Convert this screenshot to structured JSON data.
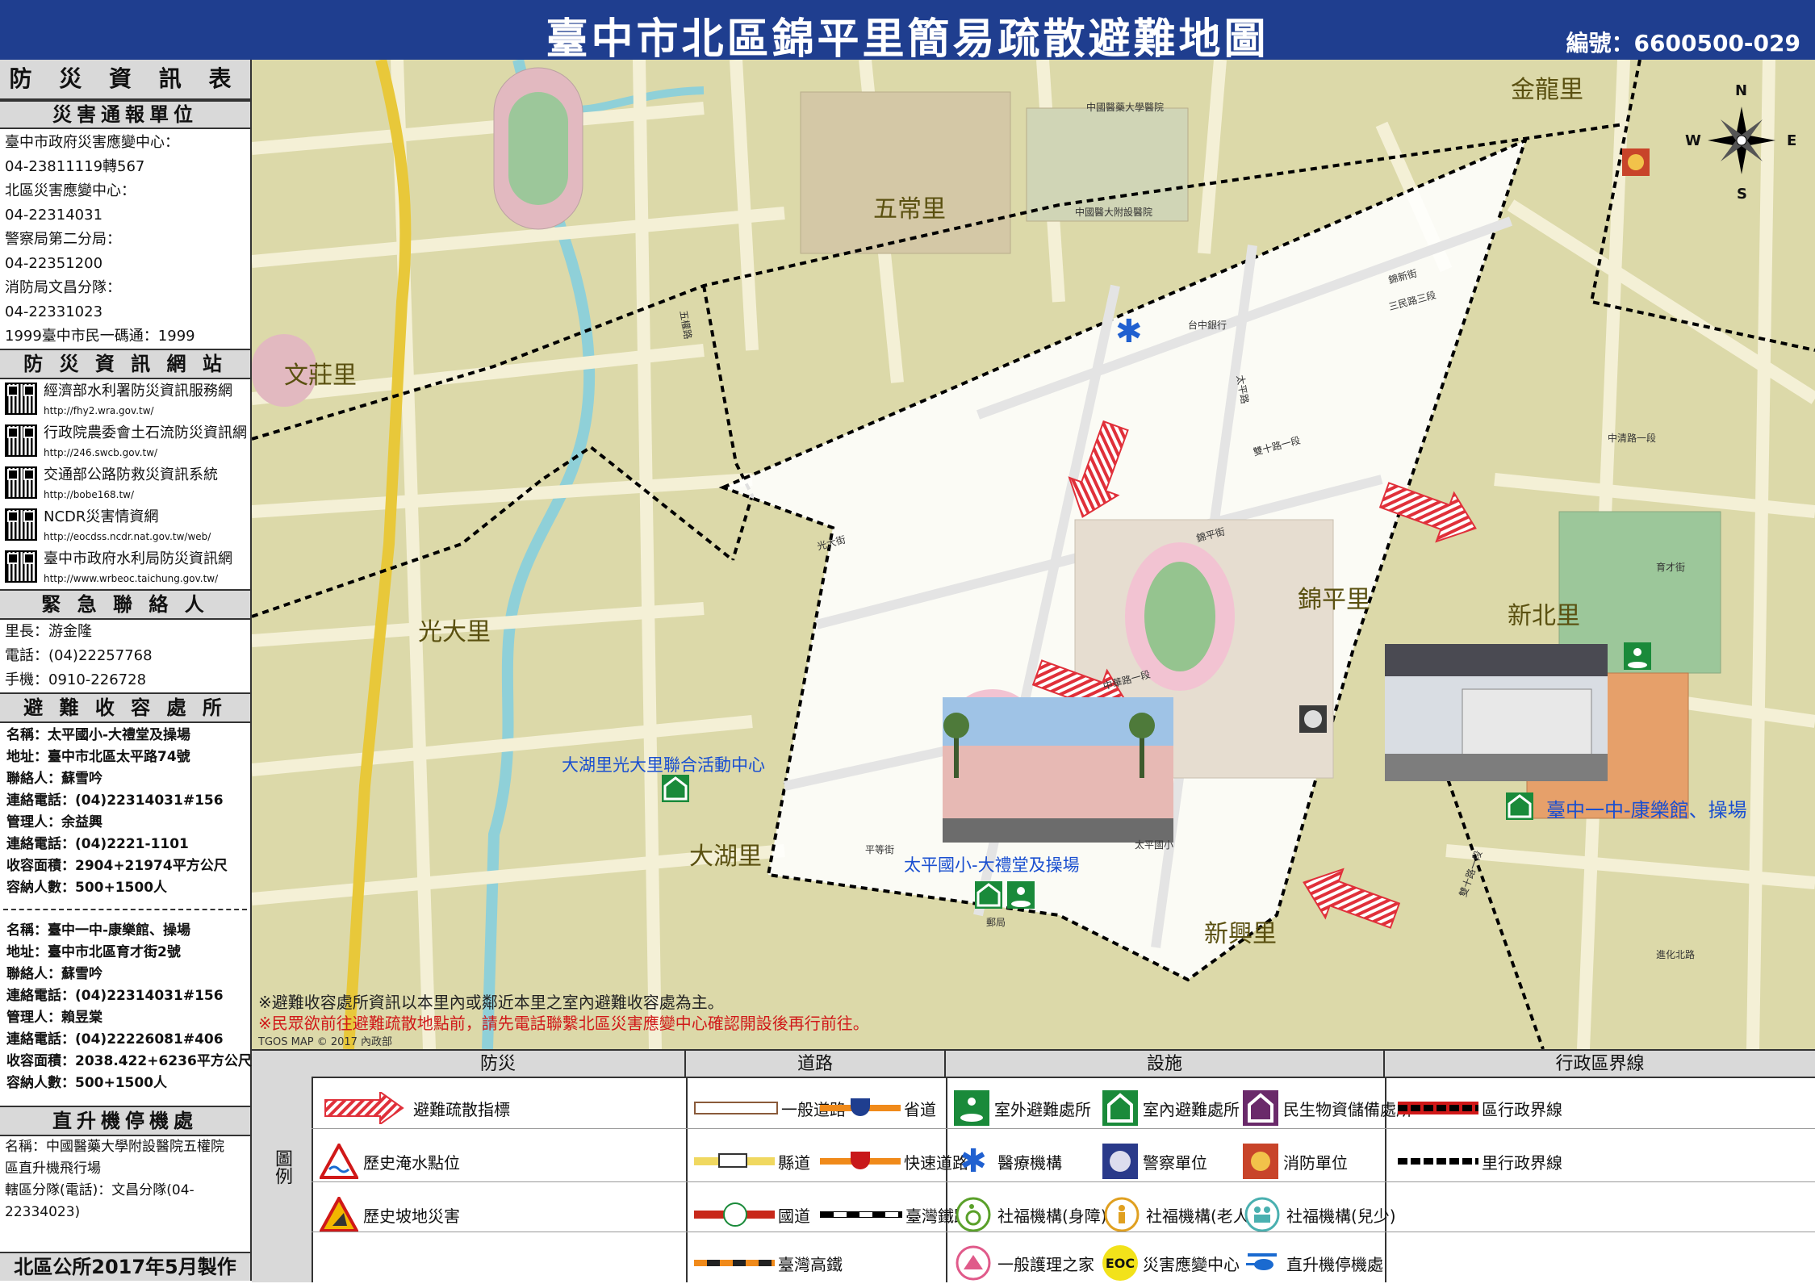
{
  "header": {
    "title": "臺中市北區錦平里簡易疏散避難地圖",
    "code": "編號：6600500-029"
  },
  "left": {
    "info_title": "防 災 資 訊 表",
    "report_title": "災害通報單位",
    "report_lines": [
      "臺中市政府災害應變中心：",
      "04-23811119轉567",
      "北區災害應變中心：",
      "04-22314031",
      "警察局第二分局：",
      "04-22351200",
      "消防局文昌分隊：",
      "04-22331023",
      "1999臺中市民一碼通：1999"
    ],
    "web_title": "防 災 資 訊 網 站",
    "webs": [
      {
        "name": "經濟部水利署防災資訊服務網",
        "url": "http://fhy2.wra.gov.tw/"
      },
      {
        "name": "行政院農委會土石流防災資訊網",
        "url": "http://246.swcb.gov.tw/"
      },
      {
        "name": "交通部公路防救災資訊系統",
        "url": "http://bobe168.tw/"
      },
      {
        "name": "NCDR災害情資網",
        "url": "http://eocdss.ncdr.nat.gov.tw/web/"
      },
      {
        "name": "臺中市政府水利局防災資訊網",
        "url": "http://www.wrbeoc.taichung.gov.tw/"
      }
    ],
    "contact_title": "緊 急 聯 絡 人",
    "contact_lines": [
      "里長：游金隆",
      "電話：(04)22257768",
      "手機：0910-226728"
    ],
    "shelter_title": "避 難 收 容 處 所",
    "shelter1": [
      "名稱：太平國小-大禮堂及操場",
      "地址：臺中市北區太平路74號",
      "聯絡人：蘇雪吟",
      "連絡電話：(04)22314031#156",
      "管理人：余益興",
      "連絡電話：(04)2221-1101",
      "收容面積：2904+21974平方公尺",
      "容納人數：500+1500人"
    ],
    "shelter2": [
      "名稱：臺中一中-康樂館、操場",
      "地址：臺中市北區育才街2號",
      "聯絡人：蘇雪吟",
      "連絡電話：(04)22314031#156",
      "管理人：賴昱棠",
      "連絡電話：(04)22226081#406",
      "收容面積：2038.422+6236平方公尺",
      "容納人數：500+1500人"
    ],
    "heli_title": "直升機停機處",
    "heli_lines": [
      "名稱：中國醫藥大學附設醫院五權院",
      "區直升機飛行場",
      "轄區分隊(電話)：文昌分隊(04-",
      "22334023)"
    ],
    "footer": "北區公所2017年5月製作"
  },
  "map": {
    "villages": {
      "jinping": "錦平里",
      "wuchang": "五常里",
      "jinlong": "金龍里",
      "wenzhuang": "文莊里",
      "guangda": "光大里",
      "dahu": "大湖里",
      "xinbei": "新北里",
      "xinxing": "新興里"
    },
    "places": {
      "community_center": "大湖里光大里聯合活動中心",
      "shelter1_label": "太平國小-大禮堂及操場",
      "shelter2_label": "臺中一中-康樂館、操場",
      "hospital1": "中國醫藥大學醫院",
      "hospital2": "中國醫大附設醫院",
      "school": "太平國小",
      "bank": "台中銀行",
      "post": "郵局"
    },
    "roads": {
      "r1": "五權路",
      "r2": "錦平街",
      "r3": "太平路",
      "r4": "中華路一段",
      "r5": "三民路三段",
      "r6": "雙十路一段",
      "r7": "中清路一段",
      "r8": "育才街",
      "r9": "進化北路",
      "r10": "錦新街",
      "r11": "光大街",
      "r12": "平等街",
      "r13": "雙十路一段"
    },
    "notes": [
      "※避難收容處所資訊以本里內或鄰近本里之室內避難收容處為主。",
      "※民眾欲前往避難疏散地點前，請先電話聯繫北區災害應變中心確認開設後再行前往。"
    ],
    "attribution": "TGOS MAP © 2017 內政部",
    "compass": {
      "n": "N",
      "s": "S",
      "e": "E",
      "w": "W"
    },
    "colors": {
      "land": "#dcd9a9",
      "district": "#ffffff",
      "arrow": "#e0303a",
      "label": "#1a4fd0"
    }
  },
  "legend": {
    "side": "圖例",
    "heads": {
      "disaster": "防災",
      "road": "道路",
      "facility": "設施",
      "boundary": "行政區界線"
    },
    "disaster": [
      "避難疏散指標",
      "歷史淹水點位",
      "歷史坡地災害"
    ],
    "road": [
      "一般道路",
      "省道",
      "縣道",
      "快速道路",
      "國道",
      "臺灣鐵路",
      "臺灣高鐵"
    ],
    "facility": [
      "室外避難處所",
      "室內避難處所",
      "民生物資儲備處所",
      "醫療機構",
      "警察單位",
      "消防單位",
      "社福機構(身障)",
      "社福機構(老人)",
      "社福機構(兒少)",
      "一般護理之家",
      "災害應變中心",
      "直升機停機處"
    ],
    "boundary": [
      "區行政界線",
      "里行政界線"
    ],
    "eoc": "EOC"
  }
}
